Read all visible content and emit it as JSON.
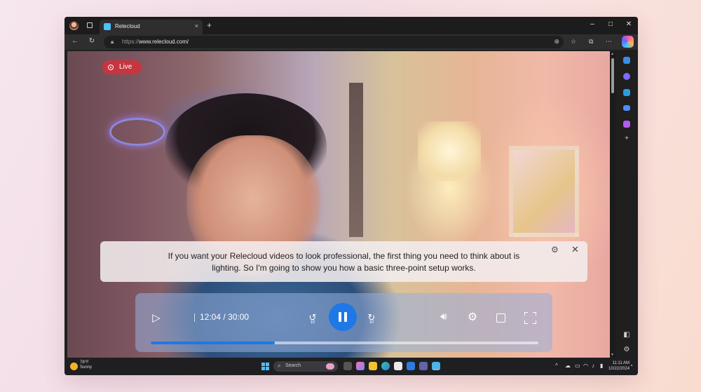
{
  "browser": {
    "tab_title": "Relecloud",
    "tab_close": "×",
    "new_tab": "+",
    "url_scheme": "https://",
    "url_host": "www.relecloud.com/",
    "window_controls": {
      "minimize": "–",
      "maximize": "□",
      "close": "✕"
    },
    "nav": {
      "back": "←",
      "refresh": "↻"
    }
  },
  "video": {
    "live_label": "Live",
    "caption_text": "If you want your Relecloud videos to look professional, the first thing you need to think about is lighting. So I'm going to show you how a basic three-point setup works.",
    "time_display": "12:04 / 30:00",
    "skip_back_seconds": "10",
    "skip_forward_seconds": "10",
    "progress_fraction": 0.32,
    "accent_color": "#1e78e6",
    "live_color": "#c7353f"
  },
  "taskbar": {
    "weather_temp": "78°F",
    "weather_cond": "Sunny",
    "search_placeholder": "Search",
    "time": "11:11 AM",
    "date": "10/22/2024"
  }
}
